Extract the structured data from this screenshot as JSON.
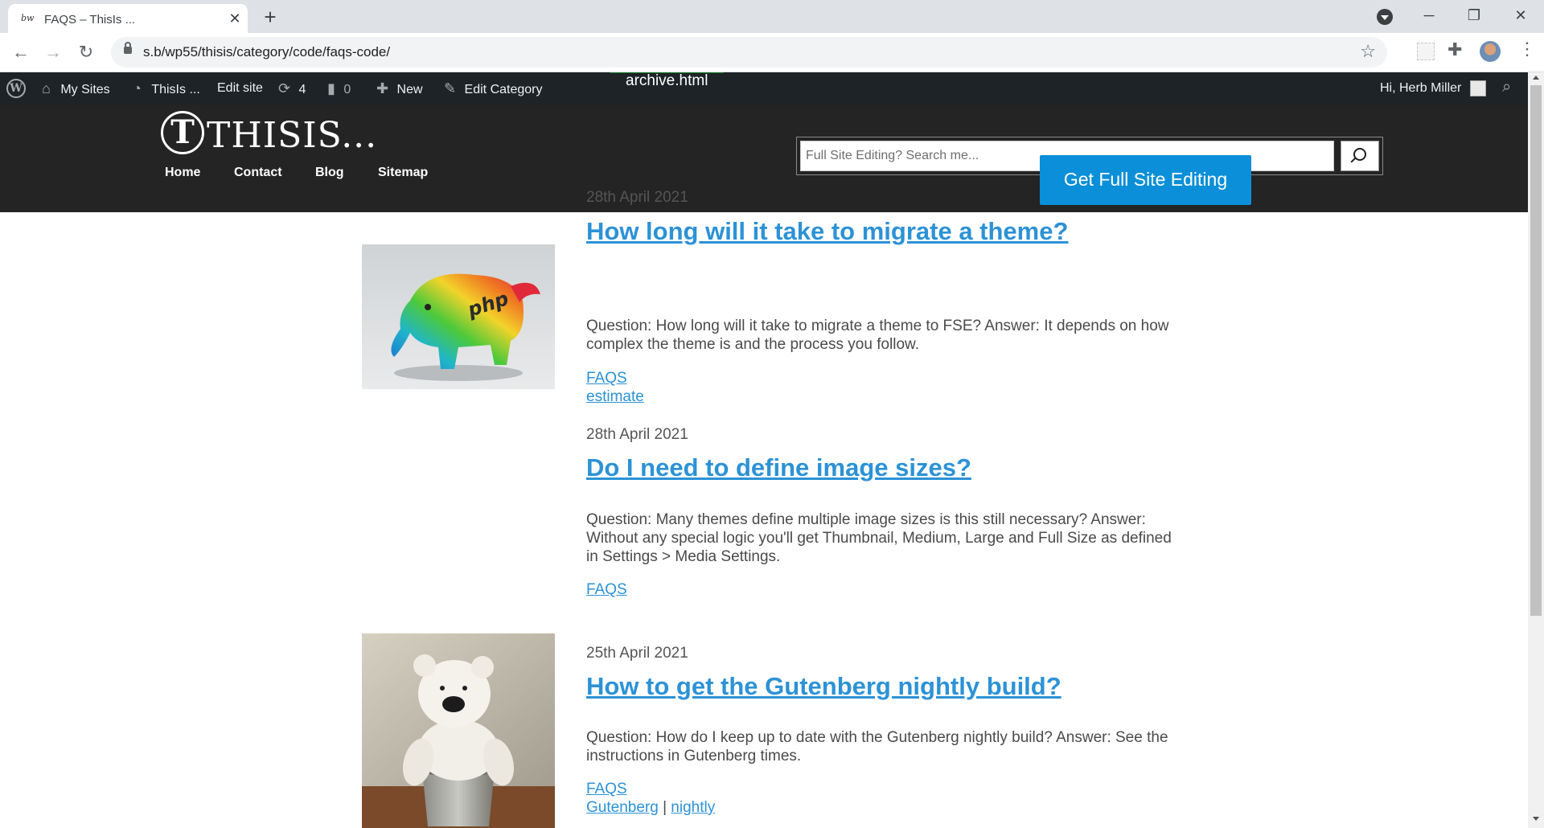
{
  "browser": {
    "tab_title": "FAQS – ThisIs ...",
    "tab_favicon": "bw",
    "url": "s.b/wp55/thisis/category/code/faqs-code/"
  },
  "adminbar": {
    "my_sites": "My Sites",
    "site_name": "ThisIs ...",
    "edit_site": "Edit site",
    "updates_count": "4",
    "comments_count": "0",
    "new": "New",
    "edit_category": "Edit Category",
    "template_label": "archive.html",
    "howdy": "Hi, Herb Miller"
  },
  "header": {
    "logo_letter": "T",
    "logo_text": "THISIS...",
    "nav": [
      "Home",
      "Contact",
      "Blog",
      "Sitemap"
    ],
    "search_placeholder": "Full Site Editing? Search me...",
    "cta_label": "Get Full Site Editing"
  },
  "posts": [
    {
      "date": "28th April 2021",
      "title": "How long will it take to migrate a theme?",
      "excerpt": "Question: How long will it take to migrate a theme to FSE? Answer: It depends on how complex the theme is and the process you follow.",
      "category": "FAQS",
      "tags": [
        "estimate"
      ],
      "thumbnail": "php elephant"
    },
    {
      "date": "28th April 2021",
      "title": "Do I need to define image sizes?",
      "excerpt": "Question: Many themes define multiple image sizes is this still necessary? Answer: Without any special logic you'll get Thumbnail, Medium, Large and Full Size as defined in Settings > Media Settings.",
      "category": "FAQS",
      "tags": []
    },
    {
      "date": "25th April 2021",
      "title": "How to get the Gutenberg nightly build?",
      "excerpt": "Question: How do I keep up to date with the Gutenberg nightly build? Answer: See the instructions in Gutenberg times.",
      "category": "FAQS",
      "tags": [
        "Gutenberg",
        "nightly"
      ],
      "tag_separator": "|",
      "thumbnail": "teddy bear in bucket"
    }
  ],
  "colors": {
    "admin_bar": "#1d2327",
    "header_bg": "#242424",
    "link": "#2c92d6",
    "cta": "#0a8fd8"
  }
}
